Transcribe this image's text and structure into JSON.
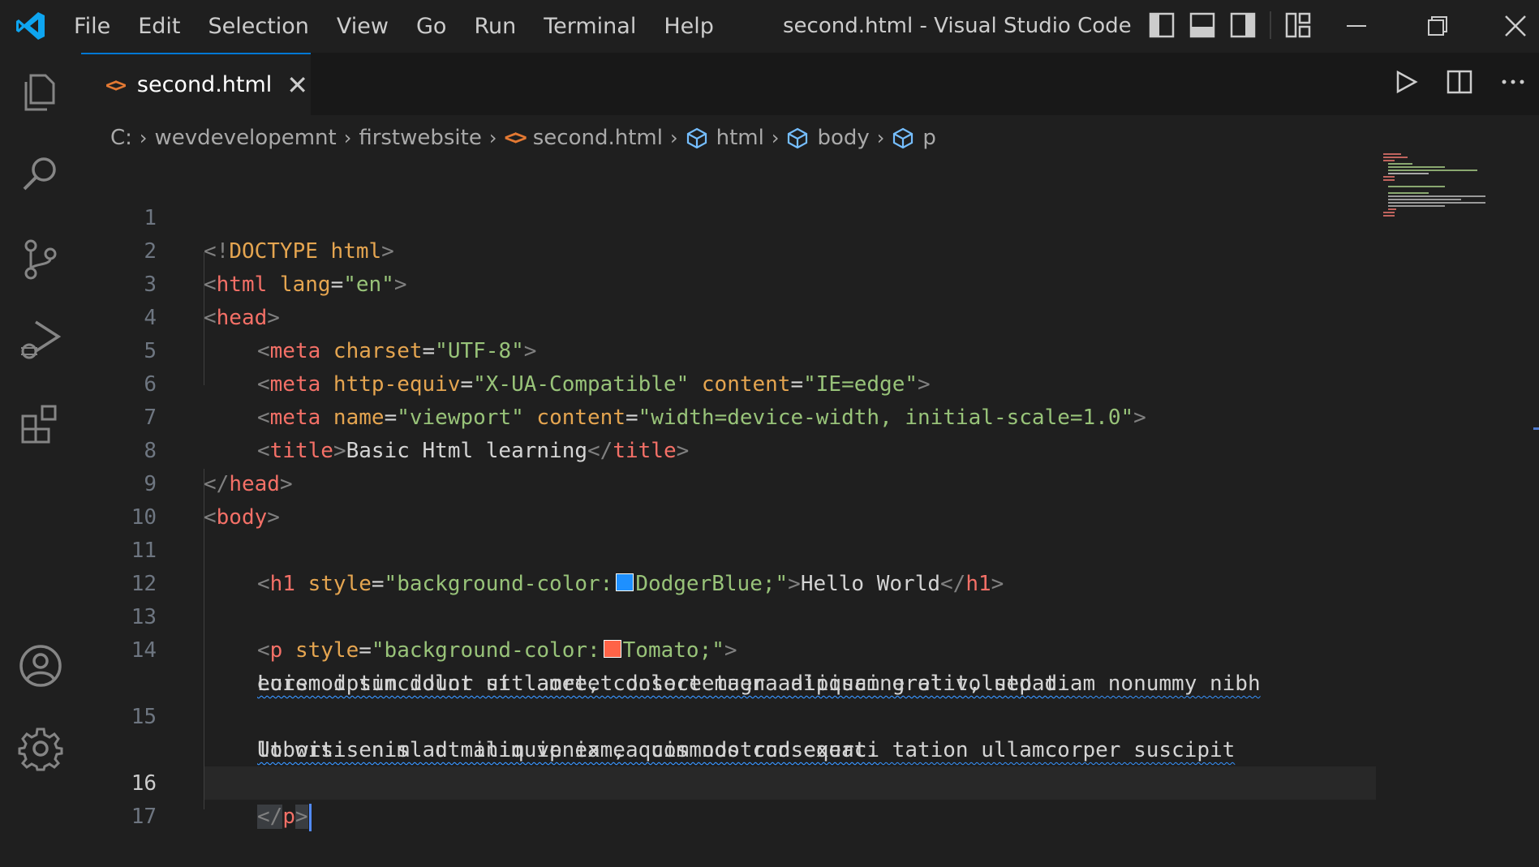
{
  "titlebar": {
    "menu": [
      "File",
      "Edit",
      "Selection",
      "View",
      "Go",
      "Run",
      "Terminal",
      "Help"
    ],
    "window_title": "second.html - Visual Studio Code"
  },
  "tab": {
    "label": "second.html",
    "icon": "<>",
    "close": "✕"
  },
  "breadcrumb": {
    "drive": "C:",
    "folder1": "wevdevelopemnt",
    "folder2": "firstwebsite",
    "file": "second.html",
    "el1": "html",
    "el2": "body",
    "el3": "p"
  },
  "line_numbers": [
    "1",
    "2",
    "3",
    "4",
    "5",
    "6",
    "7",
    "8",
    "9",
    "10",
    "11",
    "12",
    "13",
    "14",
    "15",
    "16",
    "17"
  ],
  "code": {
    "l1": [
      "<!",
      "DOCTYPE",
      " html",
      ">"
    ],
    "l2": [
      "<",
      "html",
      " lang",
      "=",
      "\"en\"",
      ">"
    ],
    "l3": [
      "<",
      "head",
      ">"
    ],
    "l4": [
      "<",
      "meta",
      " charset",
      "=",
      "\"UTF-8\"",
      ">"
    ],
    "l5": [
      "<",
      "meta",
      " http-equiv",
      "=",
      "\"X-UA-Compatible\"",
      " content",
      "=",
      "\"IE=edge\"",
      ">"
    ],
    "l6": [
      "<",
      "meta",
      " name",
      "=",
      "\"viewport\"",
      " content",
      "=",
      "\"width=device-width, initial-scale=1.0\"",
      ">"
    ],
    "l7": [
      "<",
      "title",
      ">",
      "Basic Html learning",
      "</",
      "title",
      ">"
    ],
    "l8": [
      "</",
      "head",
      ">"
    ],
    "l9": [
      "<",
      "body",
      ">"
    ],
    "l11": [
      "<",
      "h1",
      " style",
      "=",
      "\"background-color:",
      "DodgerBlue;\"",
      ">",
      "Hello World",
      "</",
      "h1",
      ">"
    ],
    "l13": [
      "<",
      "p",
      " style",
      "=",
      "\"background-color:",
      "Tomato;\"",
      ">"
    ],
    "l14a": "Lorem ipsum dolor sit amet, consectetuer adipiscing elit, sed diam nonummy nibh",
    "l14b": "euismod tincidunt ut laoreet dolore magna aliquam erat volutpat.",
    "l15a": "Ut wisi enim ad minim veniam, quis nostrud exerci tation ullamcorper suscipit",
    "l15b": "lobortis nisl ut aliquip ex ea commodo consequat.",
    "l16": [
      "</",
      "p",
      ">"
    ]
  },
  "colors": {
    "dodgerblue": "#1e90ff",
    "tomato": "#ff6347",
    "accent": "#0078d4"
  }
}
